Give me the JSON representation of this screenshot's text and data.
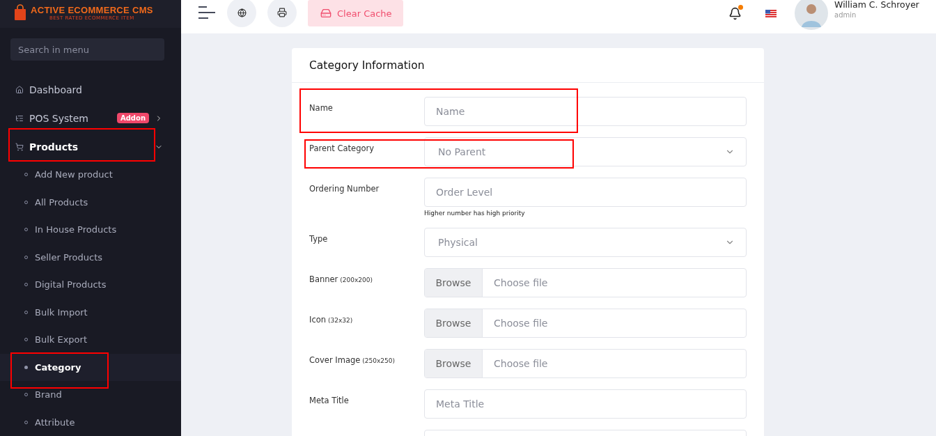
{
  "brand": {
    "title": "ACTIVE ECOMMERCE CMS",
    "tagline": "BEST RATED ECOMMERCE ITEM"
  },
  "sidebar": {
    "search": {
      "placeholder": "Search in menu"
    },
    "items": [
      {
        "label": "Dashboard",
        "selected": false,
        "highlighted": false
      },
      {
        "label": "POS System",
        "badge": "Addon",
        "selected": false,
        "highlighted": false
      },
      {
        "label": "Products",
        "selected": true,
        "expanded": true,
        "highlighted": true,
        "children": [
          {
            "label": "Add New product",
            "selected": false,
            "highlighted": false
          },
          {
            "label": "All Products",
            "selected": false,
            "highlighted": false
          },
          {
            "label": "In House Products",
            "selected": false,
            "highlighted": false
          },
          {
            "label": "Seller Products",
            "selected": false,
            "highlighted": false
          },
          {
            "label": "Digital Products",
            "selected": false,
            "highlighted": false
          },
          {
            "label": "Bulk Import",
            "selected": false,
            "highlighted": false
          },
          {
            "label": "Bulk Export",
            "selected": false,
            "highlighted": false
          },
          {
            "label": "Category",
            "selected": true,
            "highlighted": true
          },
          {
            "label": "Brand",
            "selected": false,
            "highlighted": false
          },
          {
            "label": "Attribute",
            "selected": false,
            "highlighted": false
          }
        ]
      }
    ]
  },
  "topbar": {
    "clear_cache": "Clear Cache",
    "notifications": {
      "unread": true
    },
    "user": {
      "name": "William C. Schroyer",
      "role": "admin"
    }
  },
  "card": {
    "title": "Category Information",
    "fields": [
      {
        "kind": "text",
        "label": "Name",
        "placeholder": "Name",
        "highlighted": true
      },
      {
        "kind": "select",
        "label": "Parent Category",
        "value": "No Parent",
        "highlighted": true
      },
      {
        "kind": "text",
        "label": "Ordering Number",
        "placeholder": "Order Level",
        "hint": "Higher number has high priority",
        "highlighted": false
      },
      {
        "kind": "select",
        "label": "Type",
        "value": "Physical",
        "highlighted": false
      },
      {
        "kind": "file",
        "label": "Banner",
        "note": "(200x200)",
        "button": "Browse",
        "placeholder": "Choose file",
        "highlighted": false
      },
      {
        "kind": "file",
        "label": "Icon",
        "note": "(32x32)",
        "button": "Browse",
        "placeholder": "Choose file",
        "highlighted": false
      },
      {
        "kind": "file",
        "label": "Cover Image",
        "note": "(250x250)",
        "button": "Browse",
        "placeholder": "Choose file",
        "highlighted": false
      },
      {
        "kind": "text",
        "label": "Meta Title",
        "placeholder": "Meta Title",
        "highlighted": false
      },
      {
        "kind": "text",
        "highlighted": false
      }
    ]
  }
}
